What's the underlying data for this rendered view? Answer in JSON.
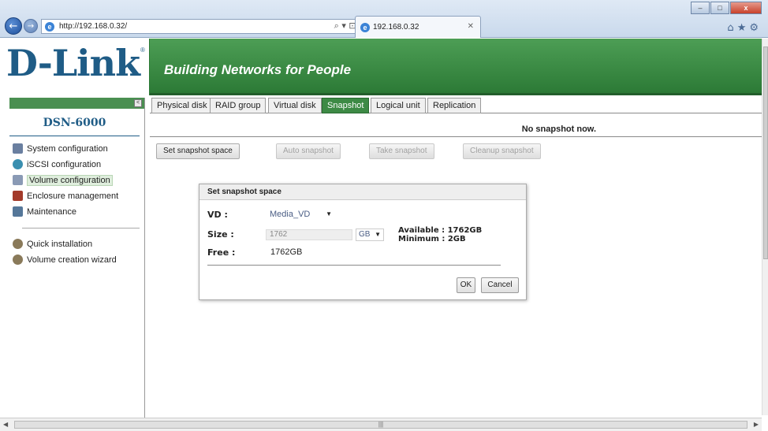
{
  "browser": {
    "url": "http://192.168.0.32/",
    "tab_title": "192.168.0.32",
    "address_tools": "⌕ ▾ ⊡ ↻ ✕",
    "tab_close": "✕"
  },
  "banner": {
    "logo": "D-Link",
    "slogan": "Building Networks for People"
  },
  "sidebar": {
    "device": "DSN-6000",
    "items": [
      {
        "label": "System configuration",
        "icon": "server-icon",
        "color": "#6a7fa0"
      },
      {
        "label": "iSCSI configuration",
        "icon": "globe-icon",
        "color": "#3a8fb0"
      },
      {
        "label": "Volume configuration",
        "icon": "disk-icon",
        "color": "#8a9ab5"
      },
      {
        "label": "Enclosure management",
        "icon": "enclosure-icon",
        "color": "#a33a2a"
      },
      {
        "label": "Maintenance",
        "icon": "toolbox-icon",
        "color": "#557799"
      }
    ],
    "extra_items": [
      {
        "label": "Quick installation",
        "icon": "wizard-icon",
        "color": "#8a7a5a"
      },
      {
        "label": "Volume creation wizard",
        "icon": "wizard-icon",
        "color": "#8a7a5a"
      }
    ]
  },
  "tabs": [
    "Physical disk",
    "RAID group",
    "Virtual disk",
    "Snapshot",
    "Logical unit",
    "Replication"
  ],
  "selected_tab": "Snapshot",
  "status": "No snapshot now.",
  "actions": {
    "set_space": "Set snapshot space",
    "auto": "Auto snapshot",
    "take": "Take snapshot",
    "cleanup": "Cleanup snapshot"
  },
  "dialog": {
    "title": "Set snapshot space",
    "vd_label": "VD :",
    "vd_value": "Media_VD",
    "size_label": "Size :",
    "size_value": "1762",
    "unit": "GB",
    "available": "Available : 1762GB",
    "minimum": "Minimum : 2GB",
    "free_label": "Free :",
    "free_value": "1762GB",
    "ok": "OK",
    "cancel": "Cancel"
  },
  "accent_color": "#3d8a45"
}
